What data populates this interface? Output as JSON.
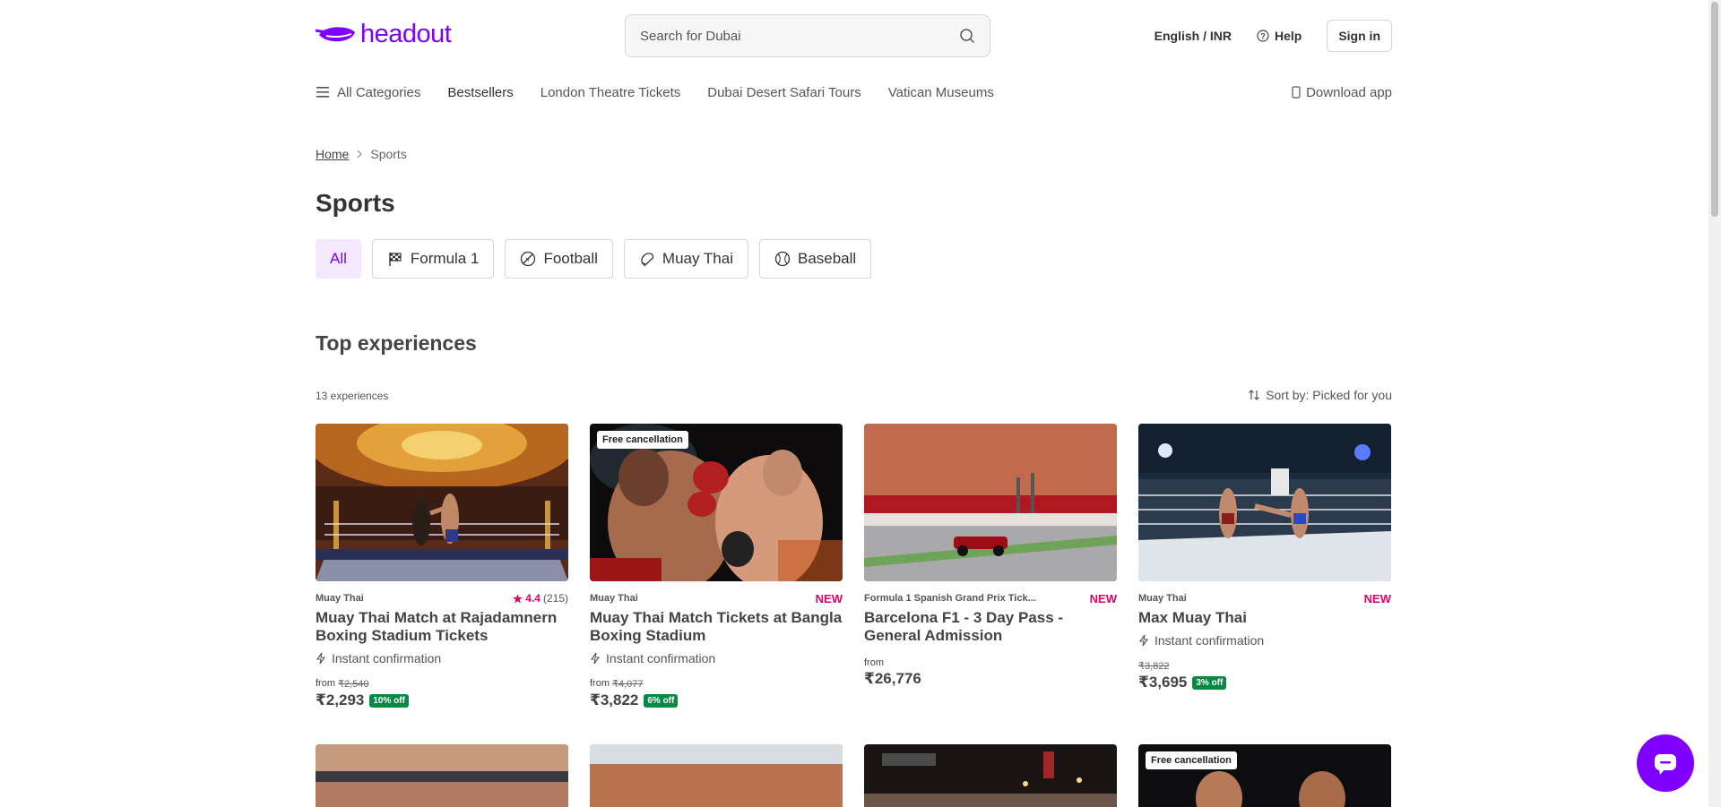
{
  "header": {
    "logo_text": "headout",
    "search_placeholder": "Search for Dubai",
    "language": "English / INR",
    "help": "Help",
    "sign_in": "Sign in",
    "brand_color": "#8000ff"
  },
  "nav": {
    "all_categories": "All Categories",
    "items": [
      "Bestsellers",
      "London Theatre Tickets",
      "Dubai Desert Safari Tours",
      "Vatican Museums"
    ],
    "download_app": "Download app"
  },
  "breadcrumb": {
    "home": "Home",
    "current": "Sports"
  },
  "page_title": "Sports",
  "chips": {
    "all": "All",
    "items": [
      {
        "label": "Formula 1",
        "icon": "checkered-flag-icon"
      },
      {
        "label": "Football",
        "icon": "football-icon"
      },
      {
        "label": "Muay Thai",
        "icon": "boxing-glove-icon"
      },
      {
        "label": "Baseball",
        "icon": "baseball-icon"
      }
    ]
  },
  "section": {
    "title": "Top experiences",
    "count": "13 experiences",
    "sort": "Sort by: Picked for you"
  },
  "cards": [
    {
      "category": "Muay Thai",
      "rating": "4.4",
      "rating_count": "(215)",
      "title": "Muay Thai Match at Rajadamnern Boxing Stadium Tickets",
      "instant": "Instant confirmation",
      "from": "from",
      "original_price": "₹2,540",
      "price": "₹2,293",
      "discount": "10% off"
    },
    {
      "badge": "Free cancellation",
      "category": "Muay Thai",
      "tag": "NEW",
      "title": "Muay Thai Match Tickets at Bangla Boxing Stadium",
      "instant": "Instant confirmation",
      "from": "from",
      "original_price": "₹4,077",
      "price": "₹3,822",
      "discount": "6% off"
    },
    {
      "category": "Formula 1 Spanish Grand Prix Tick...",
      "tag": "NEW",
      "title": "Barcelona F1 - 3 Day Pass - General Admission",
      "from": "from",
      "price": "₹26,776"
    },
    {
      "category": "Muay Thai",
      "tag": "NEW",
      "title": "Max Muay Thai",
      "instant": "Instant confirmation",
      "original_price": "₹3,822",
      "price": "₹3,695",
      "discount": "3% off"
    }
  ],
  "row2": {
    "badge": "Free cancellation"
  }
}
